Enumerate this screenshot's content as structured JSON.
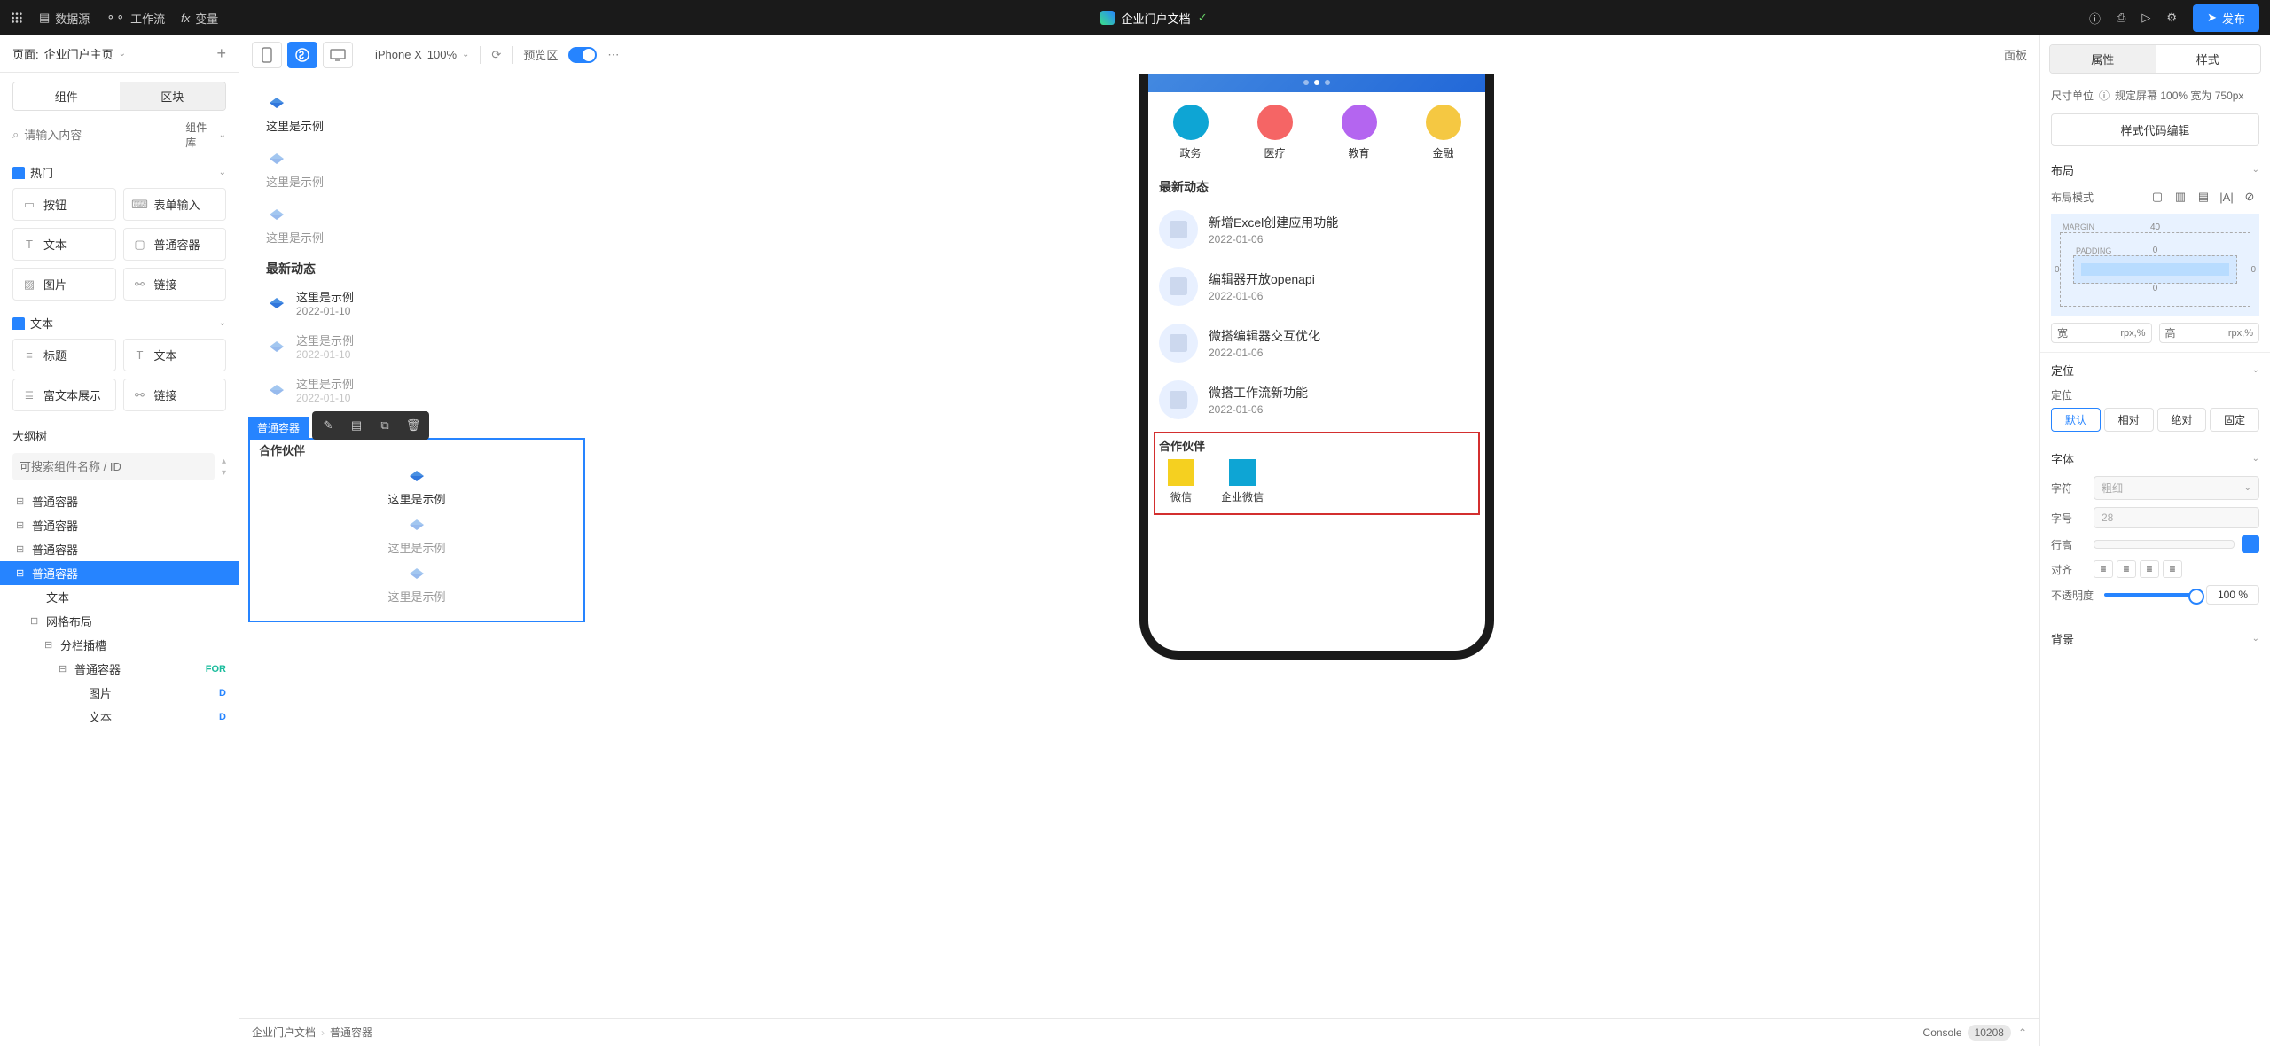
{
  "topbar": {
    "menu": [
      "数据源",
      "工作流",
      "变量"
    ],
    "doc_title": "企业门户文档",
    "publish": "发布"
  },
  "left": {
    "page_prefix": "页面:",
    "page_name": "企业门户主页",
    "tabs": [
      "组件",
      "区块"
    ],
    "search_placeholder": "请输入内容",
    "library_label": "组件库",
    "categories": {
      "hot": "热门",
      "text": "文本"
    },
    "components": {
      "button": "按钮",
      "form_input": "表单输入",
      "text": "文本",
      "container": "普通容器",
      "image": "图片",
      "link": "链接",
      "title": "标题",
      "text2": "文本",
      "richtext": "富文本展示",
      "link2": "链接"
    },
    "tree_title": "大纲树",
    "tree_search_placeholder": "可搜索组件名称 / ID",
    "tree": [
      {
        "label": "普通容器",
        "indent": 0,
        "glyph": "⊞"
      },
      {
        "label": "普通容器",
        "indent": 0,
        "glyph": "⊞"
      },
      {
        "label": "普通容器",
        "indent": 0,
        "glyph": "⊞"
      },
      {
        "label": "普通容器",
        "indent": 0,
        "glyph": "⊟",
        "selected": true
      },
      {
        "label": "文本",
        "indent": 1,
        "glyph": ""
      },
      {
        "label": "网格布局",
        "indent": 1,
        "glyph": "⊟"
      },
      {
        "label": "分栏插槽",
        "indent": 2,
        "glyph": "⊟"
      },
      {
        "label": "普通容器",
        "indent": 3,
        "glyph": "⊟",
        "badge": "FOR",
        "badgeClass": "for"
      },
      {
        "label": "图片",
        "indent": 4,
        "glyph": "",
        "badge": "D",
        "badgeClass": "d"
      },
      {
        "label": "文本",
        "indent": 4,
        "glyph": "",
        "badge": "D",
        "badgeClass": "d"
      }
    ]
  },
  "canvas": {
    "device": "iPhone X",
    "zoom": "100%",
    "preview_label": "预览区",
    "panel_label": "面板",
    "sample_text": "这里是示例",
    "news_title": "最新动态",
    "news_date": "2022-01-10",
    "sel_tag": "普通容器",
    "partner_title": "合作伙伴"
  },
  "phone": {
    "categories": [
      {
        "name": "政务",
        "color": "#0ea5d4"
      },
      {
        "name": "医疗",
        "color": "#f56565"
      },
      {
        "name": "教育",
        "color": "#b465f0"
      },
      {
        "name": "金融",
        "color": "#f5c842"
      }
    ],
    "news_section": "最新动态",
    "news": [
      {
        "title": "新增Excel创建应用功能",
        "date": "2022-01-06"
      },
      {
        "title": "编辑器开放openapi",
        "date": "2022-01-06"
      },
      {
        "title": "微搭编辑器交互优化",
        "date": "2022-01-06"
      },
      {
        "title": "微搭工作流新功能",
        "date": "2022-01-06"
      }
    ],
    "partner_title": "合作伙伴",
    "partners": [
      {
        "name": "微信",
        "color": "#f5d020"
      },
      {
        "name": "企业微信",
        "color": "#0ea5d4"
      }
    ]
  },
  "right": {
    "tabs": [
      "属性",
      "样式"
    ],
    "size_label": "尺寸单位",
    "size_info": "规定屏幕 100% 宽为 750px",
    "code_btn": "样式代码编辑",
    "layout": {
      "title": "布局",
      "mode_label": "布局模式",
      "box_top": "40",
      "box_side": "0",
      "padding_label": "PADDING",
      "margin_label": "MARGIN",
      "width_label": "宽",
      "height_label": "高",
      "unit_placeholder": "rpx,%"
    },
    "position": {
      "title": "定位",
      "label": "定位",
      "options": [
        "默认",
        "相对",
        "绝对",
        "固定"
      ]
    },
    "font": {
      "title": "字体",
      "char_label": "字符",
      "weight_placeholder": "粗细",
      "size_label": "字号",
      "size_placeholder": "28",
      "lineheight_label": "行高",
      "align_label": "对齐",
      "opacity_label": "不透明度",
      "opacity_value": "100 %"
    },
    "background": {
      "title": "背景"
    }
  },
  "bottom": {
    "breadcrumb": [
      "企业门户文档",
      "普通容器"
    ],
    "console": "Console",
    "count": "10208"
  }
}
